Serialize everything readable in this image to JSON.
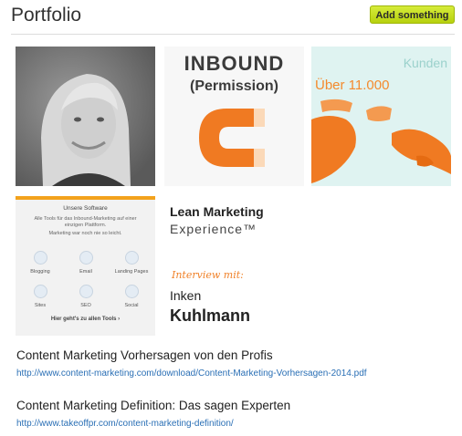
{
  "header": {
    "title": "Portfolio",
    "add_button_label": "Add something"
  },
  "tiles": {
    "inbound": {
      "title": "INBOUND",
      "subtitle": "(Permission)"
    },
    "map": {
      "label": "Kunden",
      "count": "Über 11.000"
    },
    "software": {
      "heading": "Unsere Software",
      "line1": "Alle Tools für das Inbound-Marketing auf einer",
      "line2": "einzigen Plattform.",
      "line3": "Marketing war noch nie so leicht.",
      "items": [
        "Blogging",
        "Email",
        "Landing Pages",
        "Sites",
        "SEO",
        "Social"
      ],
      "more_link": "Hier geht's zu allen Tools ›"
    },
    "lean": {
      "title": "Lean Marketing",
      "subtitle": "Experience™",
      "interview": "Interview mit:",
      "first_name": "Inken",
      "last_name": "Kuhlmann"
    }
  },
  "links": [
    {
      "title": "Content Marketing Vorhersagen von den Profis",
      "url": "http://www.content-marketing.com/download/Content-Marketing-Vorhersagen-2014.pdf"
    },
    {
      "title": "Content Marketing Definition: Das sagen Experten",
      "url": "http://www.takeoffpr.com/content-marketing-definition/"
    }
  ],
  "colors": {
    "accent_button": "#c4de1c",
    "brand_orange": "#f07a22",
    "map_sea": "#dff3f1",
    "link": "#2a6fb5"
  }
}
